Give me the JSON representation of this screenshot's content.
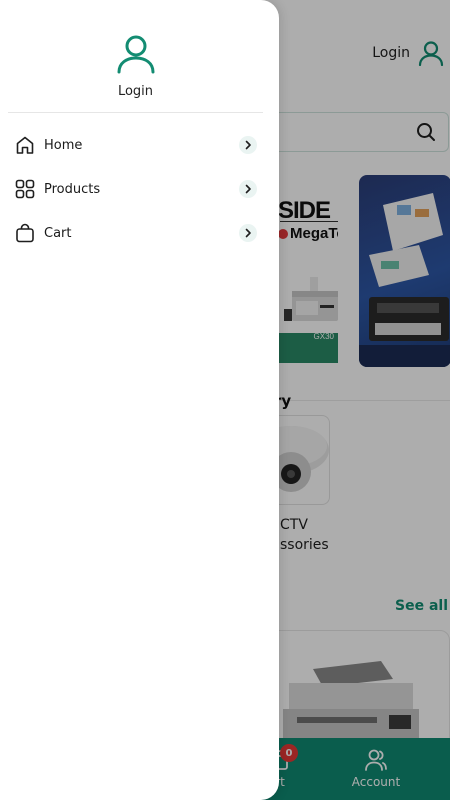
{
  "colors": {
    "accent": "#138c72",
    "bottom_nav": "#0f8a72",
    "badge": "#e53935"
  },
  "app": {
    "header_login": "Login",
    "banner1": {
      "title": "SIDE",
      "brand": "MegaTc",
      "model": "GX30"
    },
    "section_title": "ry",
    "category_label_line1": "CTV",
    "category_label_line2": "ssories",
    "see_all": "See all",
    "bottom_nav": {
      "cart_label": "rt",
      "cart_badge": "0",
      "account_label": "Account"
    }
  },
  "drawer": {
    "login_label": "Login",
    "menu": [
      {
        "label": "Home",
        "icon": "home-icon"
      },
      {
        "label": "Products",
        "icon": "grid-icon"
      },
      {
        "label": "Cart",
        "icon": "bag-icon"
      }
    ]
  }
}
